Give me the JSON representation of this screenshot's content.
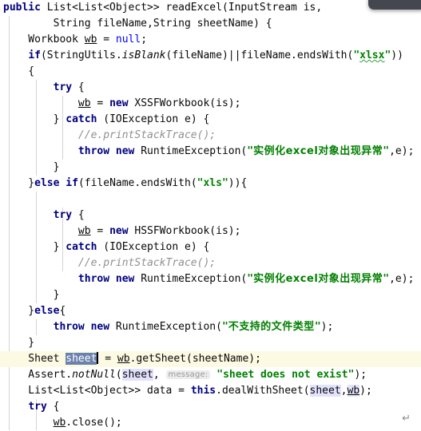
{
  "editor": {
    "language": "java",
    "theme_background": "#ffffff",
    "current_line_background": "#fcfae3",
    "selection_background": "#6b82ad",
    "usage_highlight_background": "#e2e2fd",
    "keyword_color": "#000080",
    "string_color": "#008000",
    "comment_color": "#909090",
    "hint_color": "#999999",
    "popup_color": "#44474f"
  },
  "code": {
    "line_01": {
      "kw1": "public",
      "t1": " List<List<Object>> readExcel(InputStream is,"
    },
    "line_02": {
      "t1": "        String fileName,String sheetName) {"
    },
    "line_03": {
      "t1": "    Workbook ",
      "var": "wb",
      "t2": " = ",
      "kw": "null",
      "t3": ";"
    },
    "line_04": {
      "t1": "    ",
      "kw": "if",
      "t2": "(StringUtils.",
      "mth": "isBlank",
      "t3": "(fileName)||fileName.endsWith(",
      "q1": "\"",
      "str": "xlsx",
      "q2": "\"",
      "t4": "))"
    },
    "line_05": {
      "t1": "    {"
    },
    "line_06": {
      "t1": "        ",
      "kw": "try",
      "t2": " {"
    },
    "line_07": {
      "t1": "            ",
      "var": "wb",
      "t2": " = ",
      "kw": "new",
      "t3": " XSSFWorkbook(is);"
    },
    "line_08": {
      "t1": "        } ",
      "kw": "catch",
      "t2": " (IOException e) {"
    },
    "line_09": {
      "t1": "            ",
      "cmt": "//e.printStackTrace();"
    },
    "line_10": {
      "t1": "            ",
      "kw": "throw",
      "t2": " ",
      "kw2": "new",
      "t3": " RuntimeException(",
      "q1": "\"",
      "cjk": "实例化excel对象出现异常",
      "q2": "\"",
      "t4": ",e);"
    },
    "line_11": {
      "t1": "        }"
    },
    "line_12": {
      "t1": "    }",
      "kw": "else",
      "t2": " ",
      "kw2": "if",
      "t3": "(fileName.endsWith(",
      "q1": "\"",
      "str": "xls",
      "q2": "\"",
      "t4": ")){"
    },
    "line_13": {
      "t1": ""
    },
    "line_14": {
      "t1": "        ",
      "kw": "try",
      "t2": " {"
    },
    "line_15": {
      "t1": "            ",
      "var": "wb",
      "t2": " = ",
      "kw": "new",
      "t3": " HSSFWorkbook(is);"
    },
    "line_16": {
      "t1": "        } ",
      "kw": "catch",
      "t2": " (IOException e) {"
    },
    "line_17": {
      "t1": "            ",
      "cmt": "//e.printStackTrace();"
    },
    "line_18": {
      "t1": "            ",
      "kw": "throw",
      "t2": " ",
      "kw2": "new",
      "t3": " RuntimeException(",
      "q1": "\"",
      "cjk": "实例化excel对象出现异常",
      "q2": "\"",
      "t4": ",e);"
    },
    "line_19": {
      "t1": "        }"
    },
    "line_20": {
      "t1": "    }",
      "kw": "else",
      "t2": "{"
    },
    "line_21": {
      "t1": "        ",
      "kw": "throw",
      "t2": " ",
      "kw2": "new",
      "t3": " RuntimeException(",
      "q1": "\"",
      "cjk": "不支持的文件类型",
      "q2": "\"",
      "t4": ");"
    },
    "line_22": {
      "t1": "    }"
    },
    "line_23": {
      "t1": "    Sheet ",
      "sel": "sheet",
      "t2": " = ",
      "var": "wb",
      "t3": ".getSheet(sheetName);"
    },
    "line_24": {
      "t1": "    Assert.",
      "mth": "notNull",
      "t2": "(",
      "hl": "sheet",
      "t3": ", ",
      "hint": "message:",
      "t4": " ",
      "q1": "\"",
      "str": "sheet does not exist",
      "q2": "\"",
      "t5": ");"
    },
    "line_25": {
      "t1": "    List<List<Object>> data = ",
      "kw": "this",
      "t2": ".dealWithSheet(",
      "hl": "sheet",
      "t3": ",",
      "var": "wb",
      "t4": ");"
    },
    "line_26": {
      "t1": "    ",
      "kw": "try",
      "t2": " {"
    },
    "line_27": {
      "t1": "        ",
      "var": "wb",
      "t2": ".close();"
    }
  },
  "markers": {
    "return_symbol": "↵",
    "popup_label": ""
  }
}
